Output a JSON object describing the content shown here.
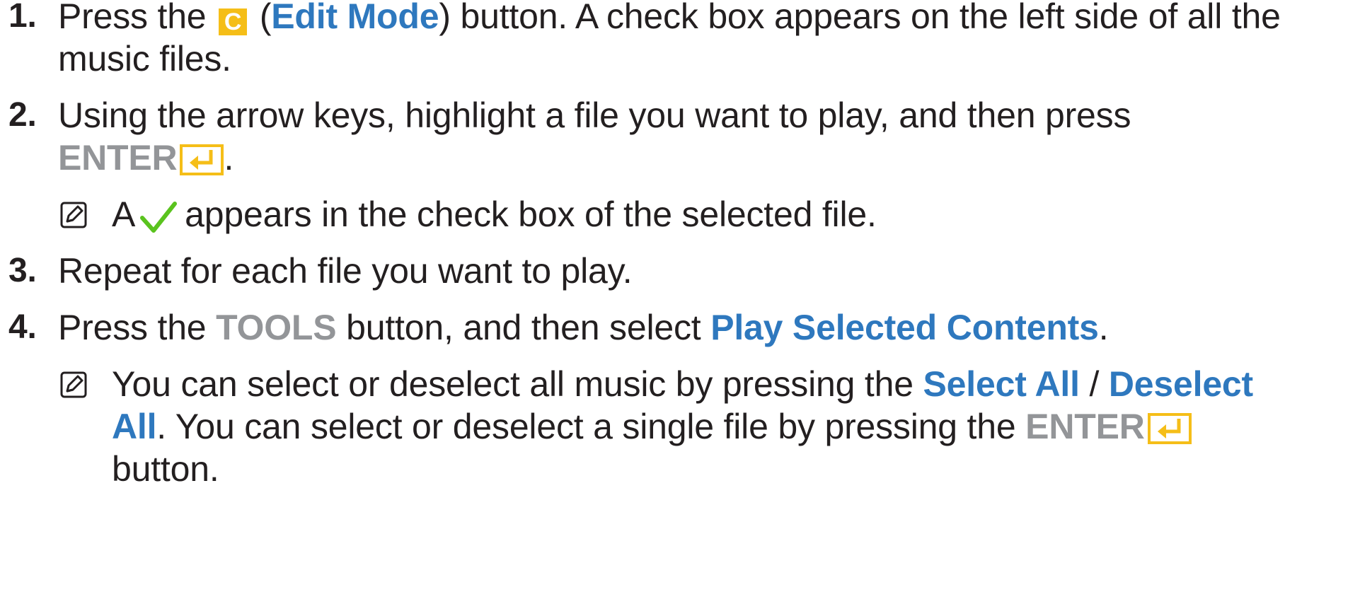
{
  "steps": [
    {
      "number": "1.",
      "line1": {
        "pre": "Press the",
        "key_label": "C",
        "paren_open": "(",
        "link": "Edit Mode",
        "post": ") button. A check box appears on the left side of all the"
      },
      "line2": "music files."
    },
    {
      "number": "2.",
      "line1": "Using the arrow keys, highlight a file you want to play, and then press",
      "line2_key": "ENTER",
      "line2_post": "."
    },
    {
      "number": "3.",
      "line1": "Repeat for each file you want to play."
    },
    {
      "number": "4.",
      "pre": "Press the",
      "key": "TOOLS",
      "mid": "button, and then select",
      "link": "Play Selected Contents",
      "post": "."
    }
  ],
  "notes": [
    {
      "pre": "A",
      "post": "appears in the check box of the selected file."
    },
    {
      "line1_pre": "You can select or deselect all music by pressing the",
      "link1": "Select All",
      "slash": "/",
      "link2_part1": "Deselect",
      "link2_part2": "All",
      "line2_mid": ". You can select or deselect a single file by pressing the",
      "key": "ENTER",
      "line3": "button."
    }
  ],
  "icons": {
    "note": "note-pencil-icon",
    "check": "green-checkmark-icon",
    "enter": "enter-key-icon",
    "key_c": "yellow-c-key-icon"
  },
  "colors": {
    "text": "#231f20",
    "link": "#2e78be",
    "key": "#939598",
    "key_c_bg": "#f5be18",
    "enter_icon": "#f5be18",
    "check": "#5ac31e"
  }
}
